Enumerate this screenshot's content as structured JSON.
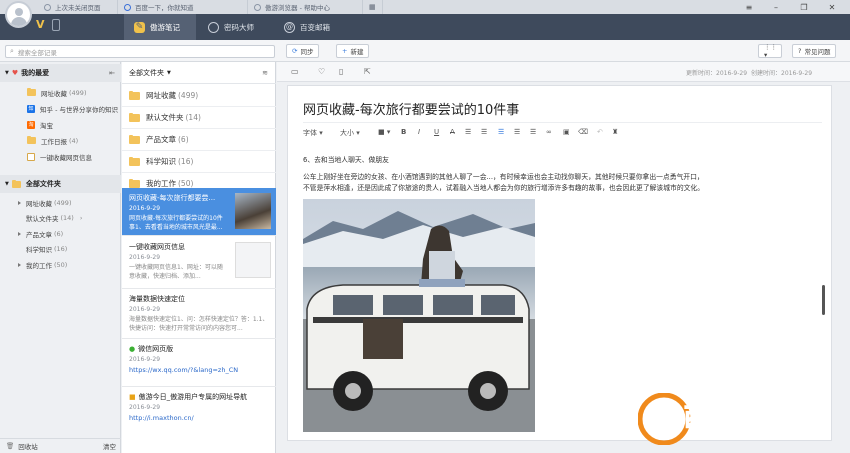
{
  "browser_tabs": [
    {
      "label": "上次未关闭页面"
    },
    {
      "label": "百度一下，你就知道"
    },
    {
      "label": "傲游浏览器 - 帮助中心"
    }
  ],
  "app_tabs": [
    {
      "label": "傲游笔记",
      "icon": "note-icon"
    },
    {
      "label": "密码大师",
      "icon": "fingerprint-icon"
    },
    {
      "label": "百变邮箱",
      "icon": "mail-icon"
    }
  ],
  "toolbar": {
    "search_placeholder": "搜索全部记录",
    "sync_label": "同步",
    "new_label": "新建",
    "help_label": "常见问题"
  },
  "favorites": {
    "title": "我的最爱",
    "items": [
      {
        "label": "网址收藏",
        "count": "(499)"
      },
      {
        "label": "知乎 - 与世界分享你的知识"
      },
      {
        "label": "淘宝"
      },
      {
        "label": "工作日报",
        "count": "(4)"
      },
      {
        "label": "一键收藏网页信息"
      }
    ]
  },
  "all_folders": {
    "title": "全部文件夹",
    "items": [
      {
        "label": "网址收藏",
        "count": "(499)"
      },
      {
        "label": "默认文件夹",
        "count": "(14)"
      },
      {
        "label": "产品文章",
        "count": "(6)"
      },
      {
        "label": "科学知识",
        "count": "(16)"
      },
      {
        "label": "我的工作",
        "count": "(50)"
      }
    ],
    "recycle_label": "回收站",
    "clear_label": "清空"
  },
  "middle": {
    "header": "全部文件夹",
    "folders": [
      {
        "label": "网址收藏",
        "count": "(499)"
      },
      {
        "label": "默认文件夹",
        "count": "(14)"
      },
      {
        "label": "产品文章",
        "count": "(6)"
      },
      {
        "label": "科学知识",
        "count": "(16)"
      },
      {
        "label": "我的工作",
        "count": "(50)"
      }
    ],
    "notes": [
      {
        "title": "网页收藏-每次旅行都要尝...",
        "date": "2016-9-29",
        "snippet": "网页收藏-每次旅行都要尝试的10件事1、去看看当地的城市风光是最...",
        "selected": true
      },
      {
        "title": "一键收藏网页信息",
        "date": "2016-9-29",
        "snippet": "一键收藏网页信息1、网址：可以随意收藏，快速归档、添加..."
      },
      {
        "title": "海量数据快速定位",
        "date": "2016-9-29",
        "snippet": "海量数据快速定位1、问：怎样快速定位？答：1.1、快捷访问：快速打开常常访问的内容您可..."
      },
      {
        "title": "微信网页版",
        "date": "2016-9-29",
        "link": "https://wx.qq.com/?&lang=zh_CN"
      },
      {
        "title": "傲游今日_傲游用户专属的网址导航",
        "date": "2016-9-29",
        "link": "http://i.maxthon.cn/"
      }
    ]
  },
  "editor": {
    "updated_label": "更新时间：2016-9-29",
    "created_label": "创建时间：2016-9-29",
    "title": "网页收藏-每次旅行都要尝试的10件事",
    "font_label": "字体",
    "size_label": "大小",
    "heading": "6、去和当地人聊天、做朋友",
    "paragraph_line1": "公车上刚好坐在旁边的女孩、在小酒馆遇到的其他人聊了一会...，有时候幸运也会主动找你聊天，其他时候只要你拿出一点勇气开口，",
    "paragraph_line2": "不管是萍水相逢，还是因此成了你旅途的贵人，试着融入当地人都会为你的旅行增添许多有趣的故事，也会因此更了解该城市的文化。"
  },
  "watermark": {
    "text": "西西软件园",
    "sub": "CR173.COM"
  }
}
